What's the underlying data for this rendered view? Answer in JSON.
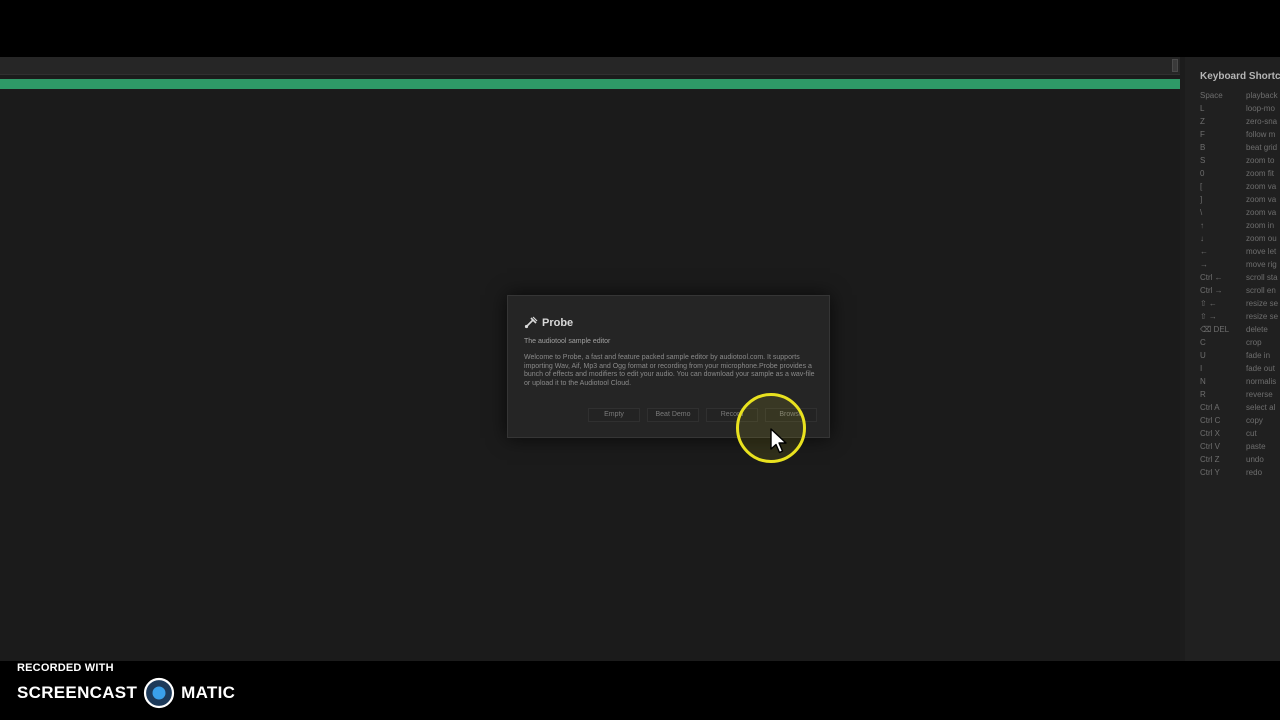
{
  "progress": {
    "fraction": 1.0,
    "color": "#2e9a67"
  },
  "shortcuts": {
    "title": "Keyboard Shortc",
    "rows": [
      {
        "key": "Space",
        "action": "playback"
      },
      {
        "key": "L",
        "action": "loop-mo"
      },
      {
        "key": "Z",
        "action": "zero-sna"
      },
      {
        "key": "F",
        "action": "follow m"
      },
      {
        "key": "B",
        "action": "beat grid"
      },
      {
        "key": "S",
        "action": "zoom to"
      },
      {
        "key": "0",
        "action": "zoom fit"
      },
      {
        "key": "[",
        "action": "zoom va"
      },
      {
        "key": "]",
        "action": "zoom va"
      },
      {
        "key": "\\",
        "action": "zoom va"
      },
      {
        "key": "↑",
        "action": "zoom in"
      },
      {
        "key": "↓",
        "action": "zoom ou"
      },
      {
        "key": "←",
        "action": "move let"
      },
      {
        "key": "→",
        "action": "move rig"
      },
      {
        "key": "Ctrl ←",
        "action": "scroll sta"
      },
      {
        "key": "Ctrl →",
        "action": "scroll en"
      },
      {
        "key": "⇧ ←",
        "action": "resize se"
      },
      {
        "key": "⇧ →",
        "action": "resize se"
      },
      {
        "key": "⌫ DEL",
        "action": "delete"
      },
      {
        "key": "C",
        "action": "crop"
      },
      {
        "key": "U",
        "action": "fade in"
      },
      {
        "key": "I",
        "action": "fade out"
      },
      {
        "key": "N",
        "action": "normalis"
      },
      {
        "key": "R",
        "action": "reverse"
      },
      {
        "key": "Ctrl A",
        "action": "select al"
      },
      {
        "key": "Ctrl C",
        "action": "copy"
      },
      {
        "key": "Ctrl X",
        "action": "cut"
      },
      {
        "key": "Ctrl V",
        "action": "paste"
      },
      {
        "key": "Ctrl Z",
        "action": "undo"
      },
      {
        "key": "Ctrl Y",
        "action": "redo"
      }
    ]
  },
  "dialog": {
    "icon": "probe-icon",
    "title": "Probe",
    "subtitle": "The audiotool sample editor",
    "description": "Welcome to Probe, a fast and feature packed sample editor by audiotool.com. It supports importing Wav, Aif, Mp3 and Ogg format or recording from your microphone.Probe provides a bunch of effects and modifiers to edit your audio. You can download your sample as a wav-file or upload it to the Audiotool Cloud.",
    "buttons": {
      "empty": "Empty",
      "beat_demo": "Beat Demo",
      "record": "Record",
      "browse": "Browse"
    }
  },
  "cursor": {
    "highlight_color": "#e9e21f"
  },
  "watermark": {
    "recorded_with": "RECORDED WITH",
    "brand_left": "SCREENCAST",
    "brand_right": "MATIC"
  }
}
